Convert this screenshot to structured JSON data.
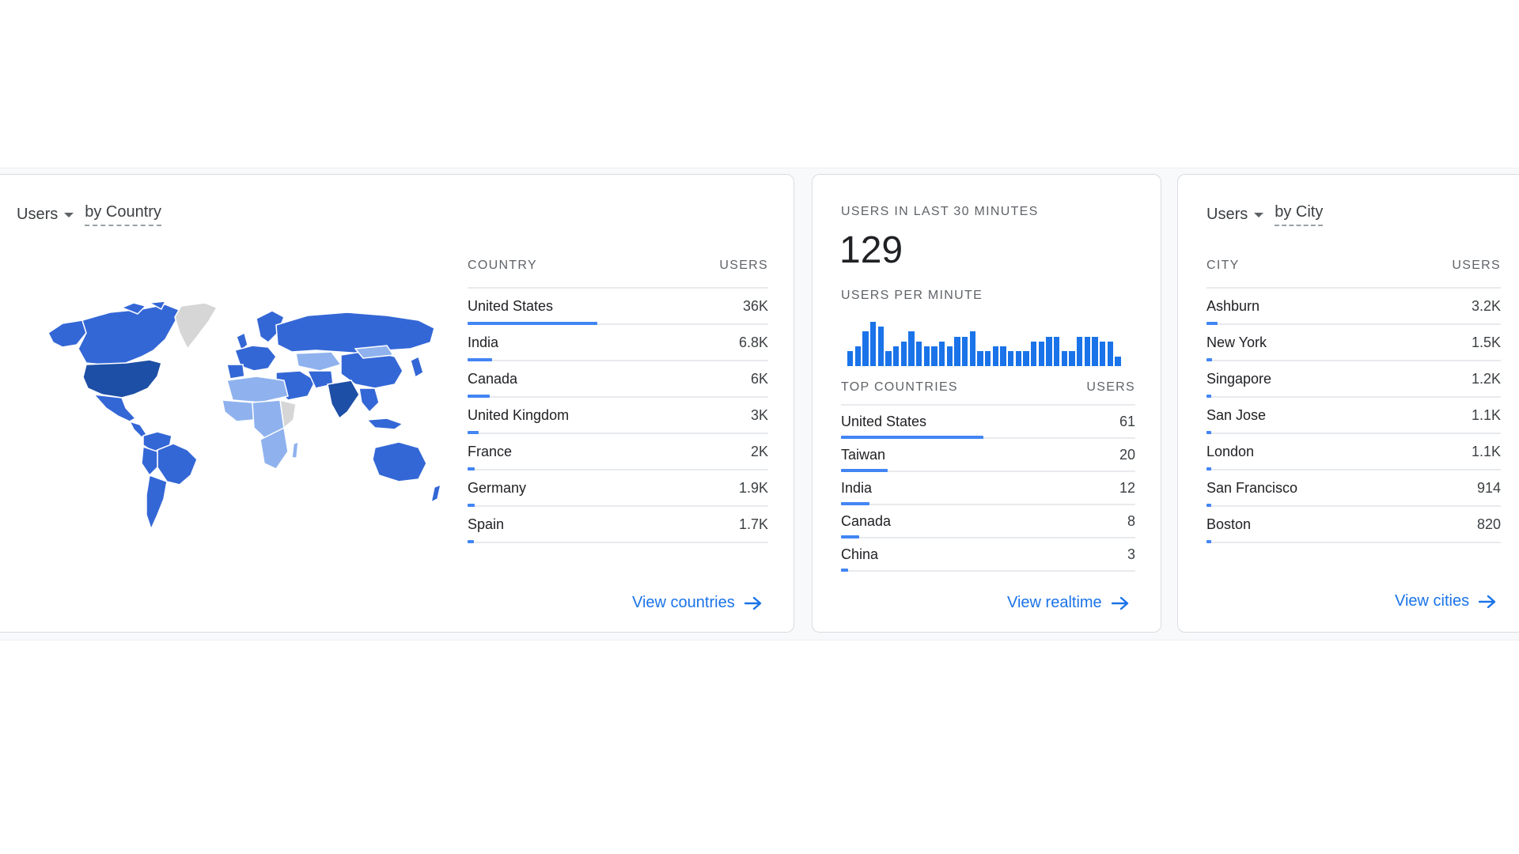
{
  "country_card": {
    "metric": "Users",
    "dimension": "by Country",
    "col_country": "COUNTRY",
    "col_users": "USERS",
    "rows": [
      {
        "name": "United States",
        "value": "36K",
        "share": 1.0
      },
      {
        "name": "India",
        "value": "6.8K",
        "share": 0.19
      },
      {
        "name": "Canada",
        "value": "6K",
        "share": 0.17
      },
      {
        "name": "United Kingdom",
        "value": "3K",
        "share": 0.085
      },
      {
        "name": "France",
        "value": "2K",
        "share": 0.056
      },
      {
        "name": "Germany",
        "value": "1.9K",
        "share": 0.053
      },
      {
        "name": "Spain",
        "value": "1.7K",
        "share": 0.047
      }
    ],
    "link": "View countries",
    "map_icon": "world-map-choropleth",
    "colors": {
      "high": "#1e4fa6",
      "mid": "#3467d6",
      "low": "#8fb2ee",
      "none": "#d6d6d6"
    }
  },
  "realtime_card": {
    "title": "USERS IN LAST 30 MINUTES",
    "count": "129",
    "per_minute_label": "USERS PER MINUTE",
    "per_minute_values": [
      3,
      4,
      7,
      9,
      8,
      3,
      4,
      5,
      7,
      5,
      4,
      4,
      5,
      4,
      6,
      6,
      7,
      3,
      3,
      4,
      4,
      3,
      3,
      3,
      5,
      5,
      6,
      6,
      3,
      3,
      6,
      6,
      6,
      5,
      5,
      2
    ],
    "col_countries": "TOP COUNTRIES",
    "col_users": "USERS",
    "rows": [
      {
        "name": "United States",
        "value": "61",
        "share": 1.0
      },
      {
        "name": "Taiwan",
        "value": "20",
        "share": 0.33
      },
      {
        "name": "India",
        "value": "12",
        "share": 0.2
      },
      {
        "name": "Canada",
        "value": "8",
        "share": 0.13
      },
      {
        "name": "China",
        "value": "3",
        "share": 0.05
      }
    ],
    "link": "View realtime"
  },
  "city_card": {
    "metric": "Users",
    "dimension": "by City",
    "col_city": "CITY",
    "col_users": "USERS",
    "rows": [
      {
        "name": "Ashburn",
        "value": "3.2K",
        "share": 0.09
      },
      {
        "name": "New York",
        "value": "1.5K",
        "share": 0.042
      },
      {
        "name": "Singapore",
        "value": "1.2K",
        "share": 0.033
      },
      {
        "name": "San Jose",
        "value": "1.1K",
        "share": 0.031
      },
      {
        "name": "London",
        "value": "1.1K",
        "share": 0.031
      },
      {
        "name": "San Francisco",
        "value": "914",
        "share": 0.025
      },
      {
        "name": "Boston",
        "value": "820",
        "share": 0.023
      }
    ],
    "link": "View cities"
  },
  "accent": "#1a73e8"
}
